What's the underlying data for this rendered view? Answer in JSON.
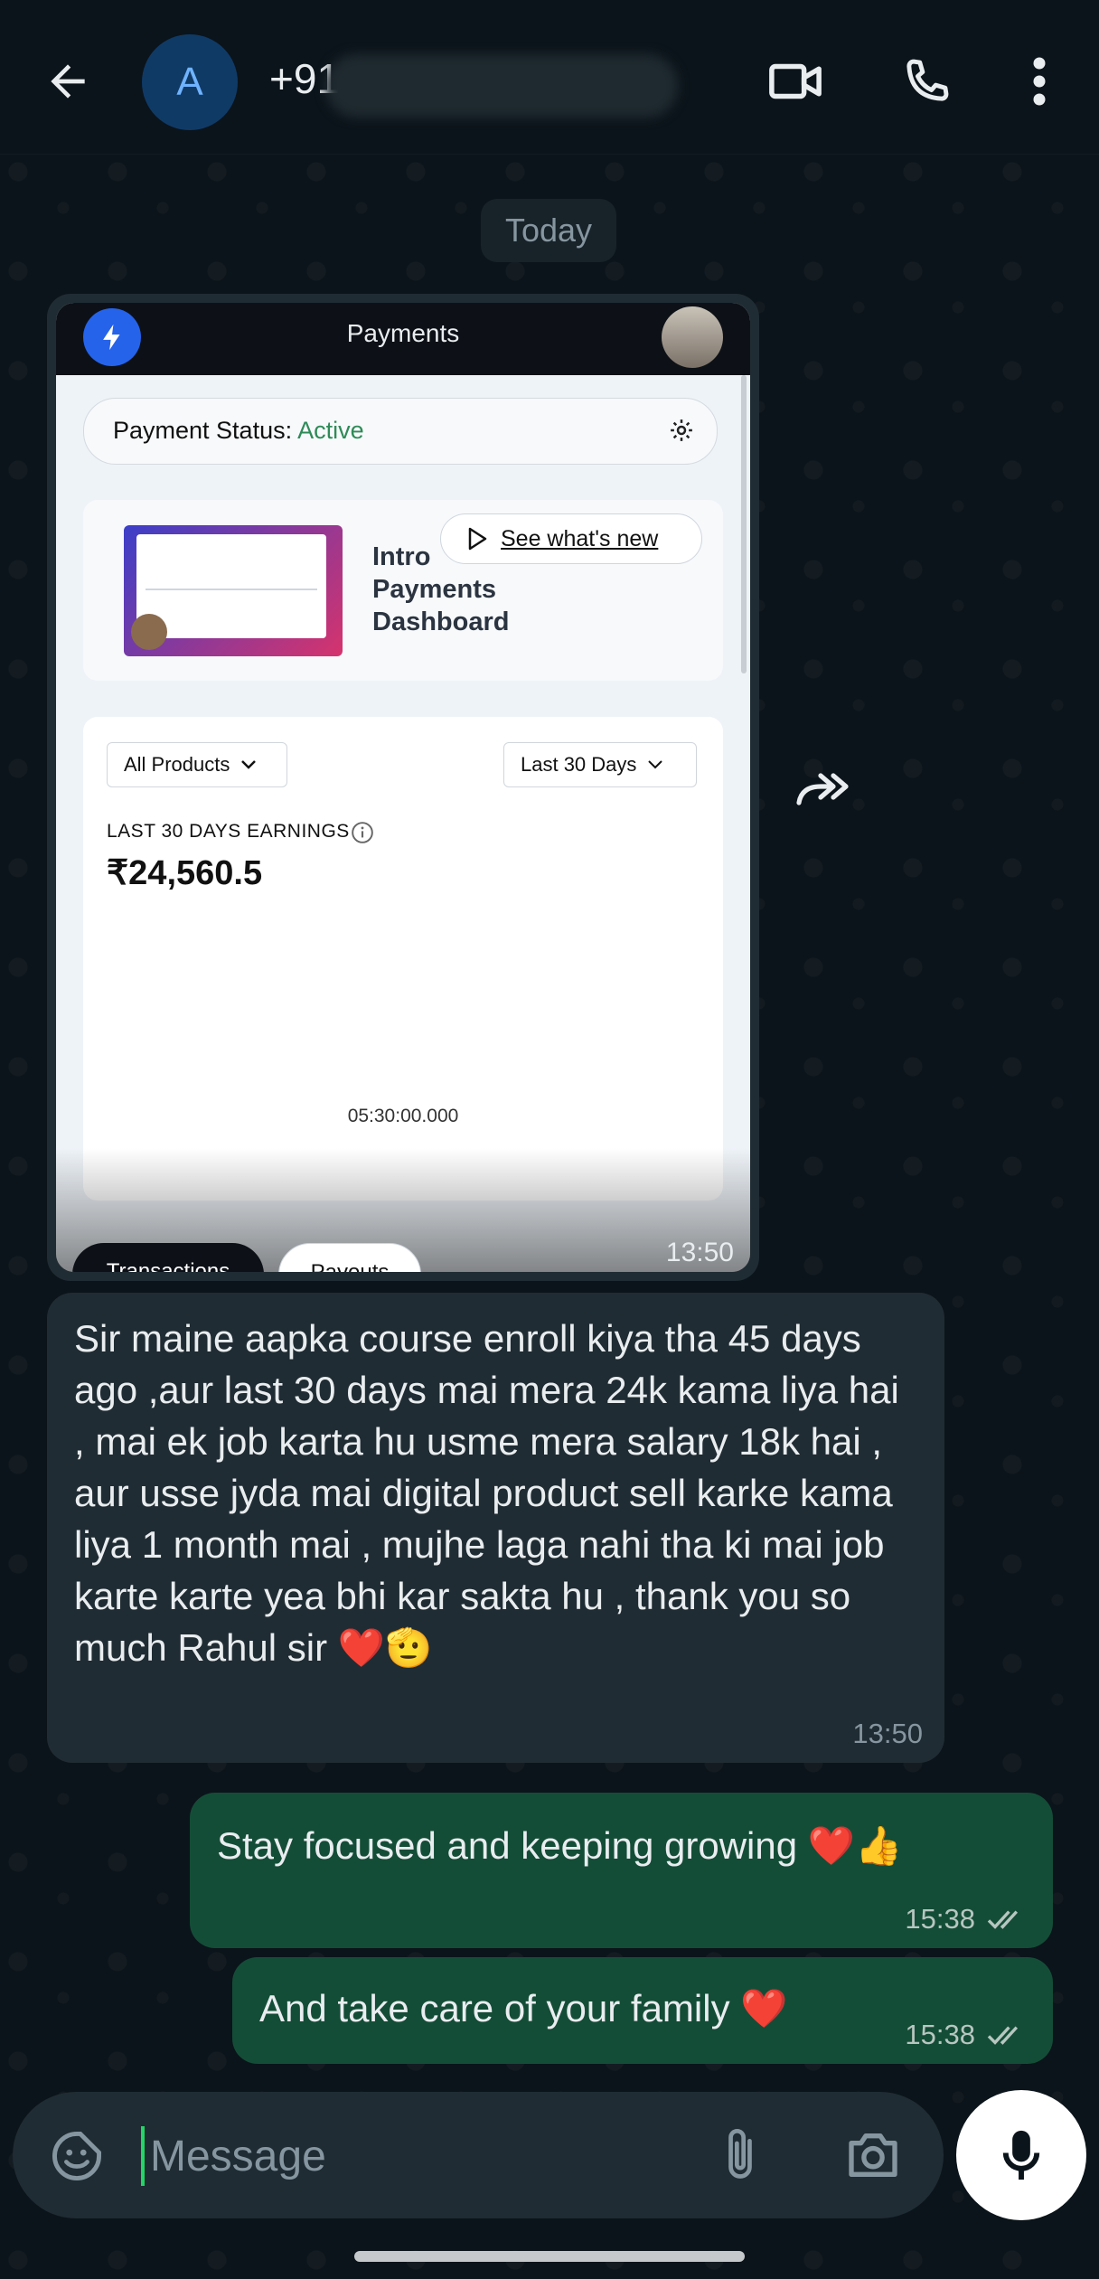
{
  "header": {
    "avatar_letter": "A",
    "contact_name": "+91",
    "icons": [
      "back-arrow-icon",
      "video-call-icon",
      "phone-icon",
      "more-vertical-icon"
    ]
  },
  "date_chip": "Today",
  "image_message": {
    "screenshot": {
      "title": "Payments",
      "status_label": "Payment Status:",
      "status_value": "Active",
      "promo_line1": "Intro",
      "promo_line2": "Payments",
      "promo_line3": "Dashboard",
      "see_new": "See what's new",
      "filter_products": "All Products",
      "filter_days": "Last 30 Days",
      "earnings_label": "LAST 30 DAYS EARNINGS",
      "earnings_value": "₹24,560.5",
      "chart_time": "05:30:00.000",
      "tab_transactions": "Transactions",
      "tab_payouts": "Payouts"
    },
    "time": "13:50"
  },
  "messages": [
    {
      "direction": "incoming",
      "text": "Sir maine aapka course enroll kiya tha 45 days ago ,aur last 30 days mai mera 24k kama liya hai , mai ek job karta hu usme mera salary 18k hai , aur usse jyda mai digital product sell karke kama liya 1 month mai , mujhe laga nahi tha ki mai job karte karte yea bhi kar sakta hu , thank you so much Rahul sir ❤️🫡",
      "time": "13:50"
    },
    {
      "direction": "outgoing",
      "text": "Stay focused and keeping growing ❤️👍",
      "time": "15:38",
      "status": "read"
    },
    {
      "direction": "outgoing",
      "text": "And take care of your family ❤️",
      "time": "15:38",
      "status": "read"
    }
  ],
  "composer": {
    "placeholder": "Message",
    "icons": [
      "emoji-sticker-icon",
      "attach-icon",
      "camera-icon",
      "mic-icon"
    ]
  },
  "colors": {
    "background": "#0b141a",
    "incoming_bubble": "#202c33",
    "outgoing_bubble": "#144d37",
    "active_status": "#2e8b57",
    "cursor": "#25d366"
  }
}
